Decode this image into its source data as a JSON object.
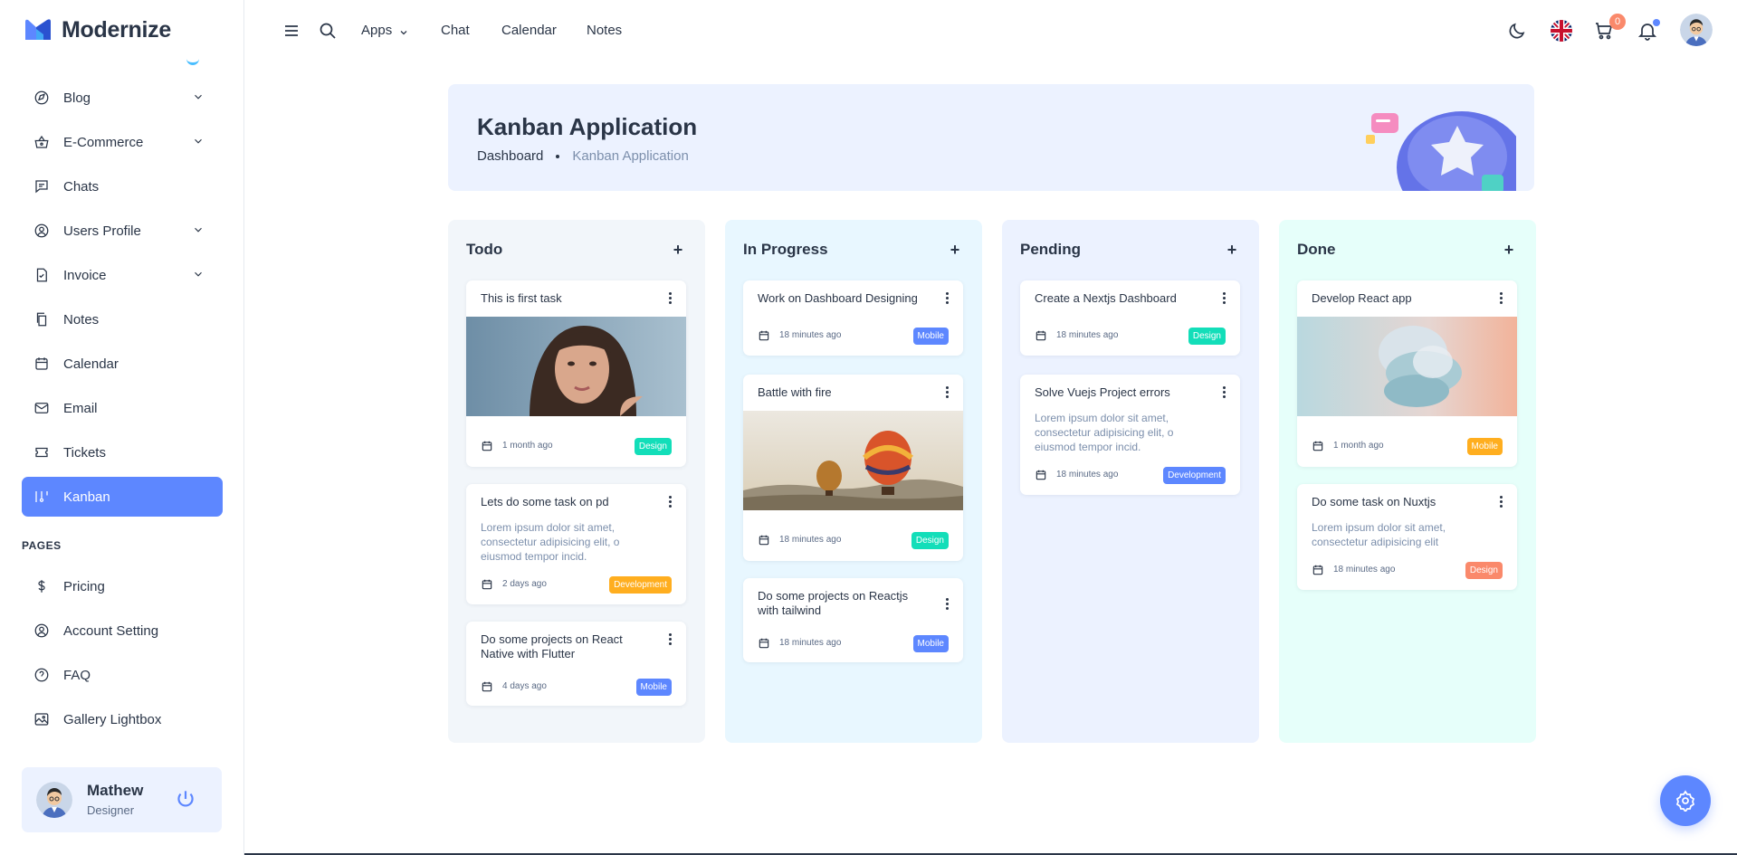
{
  "app": {
    "name": "Modernize"
  },
  "sidebar": {
    "items": [
      {
        "label": "Blog",
        "icon": "blog-icon",
        "chevron": true
      },
      {
        "label": "E-Commerce",
        "icon": "basket-icon",
        "chevron": true
      },
      {
        "label": "Chats",
        "icon": "chat-icon",
        "chevron": false
      },
      {
        "label": "Users Profile",
        "icon": "user-circle-icon",
        "chevron": true
      },
      {
        "label": "Invoice",
        "icon": "invoice-icon",
        "chevron": true
      },
      {
        "label": "Notes",
        "icon": "notes-icon",
        "chevron": false
      },
      {
        "label": "Calendar",
        "icon": "calendar-icon",
        "chevron": false
      },
      {
        "label": "Email",
        "icon": "mail-icon",
        "chevron": false
      },
      {
        "label": "Tickets",
        "icon": "ticket-icon",
        "chevron": false
      },
      {
        "label": "Kanban",
        "icon": "kanban-icon",
        "chevron": false,
        "active": true
      }
    ],
    "section_pages": "PAGES",
    "pages": [
      {
        "label": "Pricing",
        "icon": "dollar-icon"
      },
      {
        "label": "Account Setting",
        "icon": "user-circle-icon"
      },
      {
        "label": "FAQ",
        "icon": "help-icon"
      },
      {
        "label": "Gallery Lightbox",
        "icon": "gallery-icon"
      }
    ],
    "profile": {
      "name": "Mathew",
      "role": "Designer"
    }
  },
  "topbar": {
    "links": [
      "Apps",
      "Chat",
      "Calendar",
      "Notes"
    ],
    "cart_count": "0"
  },
  "banner": {
    "title": "Kanban Application",
    "crumb_home": "Dashboard",
    "crumb_current": "Kanban Application"
  },
  "columns": [
    {
      "title": "Todo",
      "bg": "#f2f6fa",
      "cards": [
        {
          "title": "This is first task",
          "image": "portrait",
          "time": "1 month ago",
          "tag": "Design",
          "tag_color": "#13deb9"
        },
        {
          "title": "Lets do some task on pd",
          "desc": "Lorem ipsum dolor sit amet, consectetur adipisicing elit, o eiusmod tempor incid.",
          "time": "2 days ago",
          "tag": "Development",
          "tag_color": "#ffae1f"
        },
        {
          "title": "Do some projects on React Native with Flutter",
          "time": "4 days ago",
          "tag": "Mobile",
          "tag_color": "#5d87ff"
        }
      ]
    },
    {
      "title": "In Progress",
      "bg": "#e8f7ff",
      "cards": [
        {
          "title": "Work on Dashboard Designing",
          "time": "18 minutes ago",
          "tag": "Mobile",
          "tag_color": "#5d87ff"
        },
        {
          "title": "Battle with fire",
          "image": "balloons",
          "time": "18 minutes ago",
          "tag": "Design",
          "tag_color": "#13deb9"
        },
        {
          "title": "Do some projects on Reactjs with tailwind",
          "time": "18 minutes ago",
          "tag": "Mobile",
          "tag_color": "#5d87ff"
        }
      ]
    },
    {
      "title": "Pending",
      "bg": "#ecf2ff",
      "cards": [
        {
          "title": "Create a Nextjs Dashboard",
          "time": "18 minutes ago",
          "tag": "Design",
          "tag_color": "#13deb9"
        },
        {
          "title": "Solve Vuejs Project errors",
          "desc": "Lorem ipsum dolor sit amet, consectetur adipisicing elit, o eiusmod tempor incid.",
          "time": "18 minutes ago",
          "tag": "Development",
          "tag_color": "#5d87ff"
        }
      ]
    },
    {
      "title": "Done",
      "bg": "#e6fffa",
      "cards": [
        {
          "title": "Develop React app",
          "image": "abstract",
          "time": "1 month ago",
          "tag": "Mobile",
          "tag_color": "#ffae1f"
        },
        {
          "title": "Do some task on Nuxtjs",
          "desc": "Lorem ipsum dolor sit amet, consectetur adipisicing elit",
          "time": "18 minutes ago",
          "tag": "Design",
          "tag_color": "#fa896b"
        }
      ]
    }
  ],
  "colors": {
    "primary": "#5d87ff",
    "text": "#2a3547",
    "muted": "#7c8fac"
  }
}
